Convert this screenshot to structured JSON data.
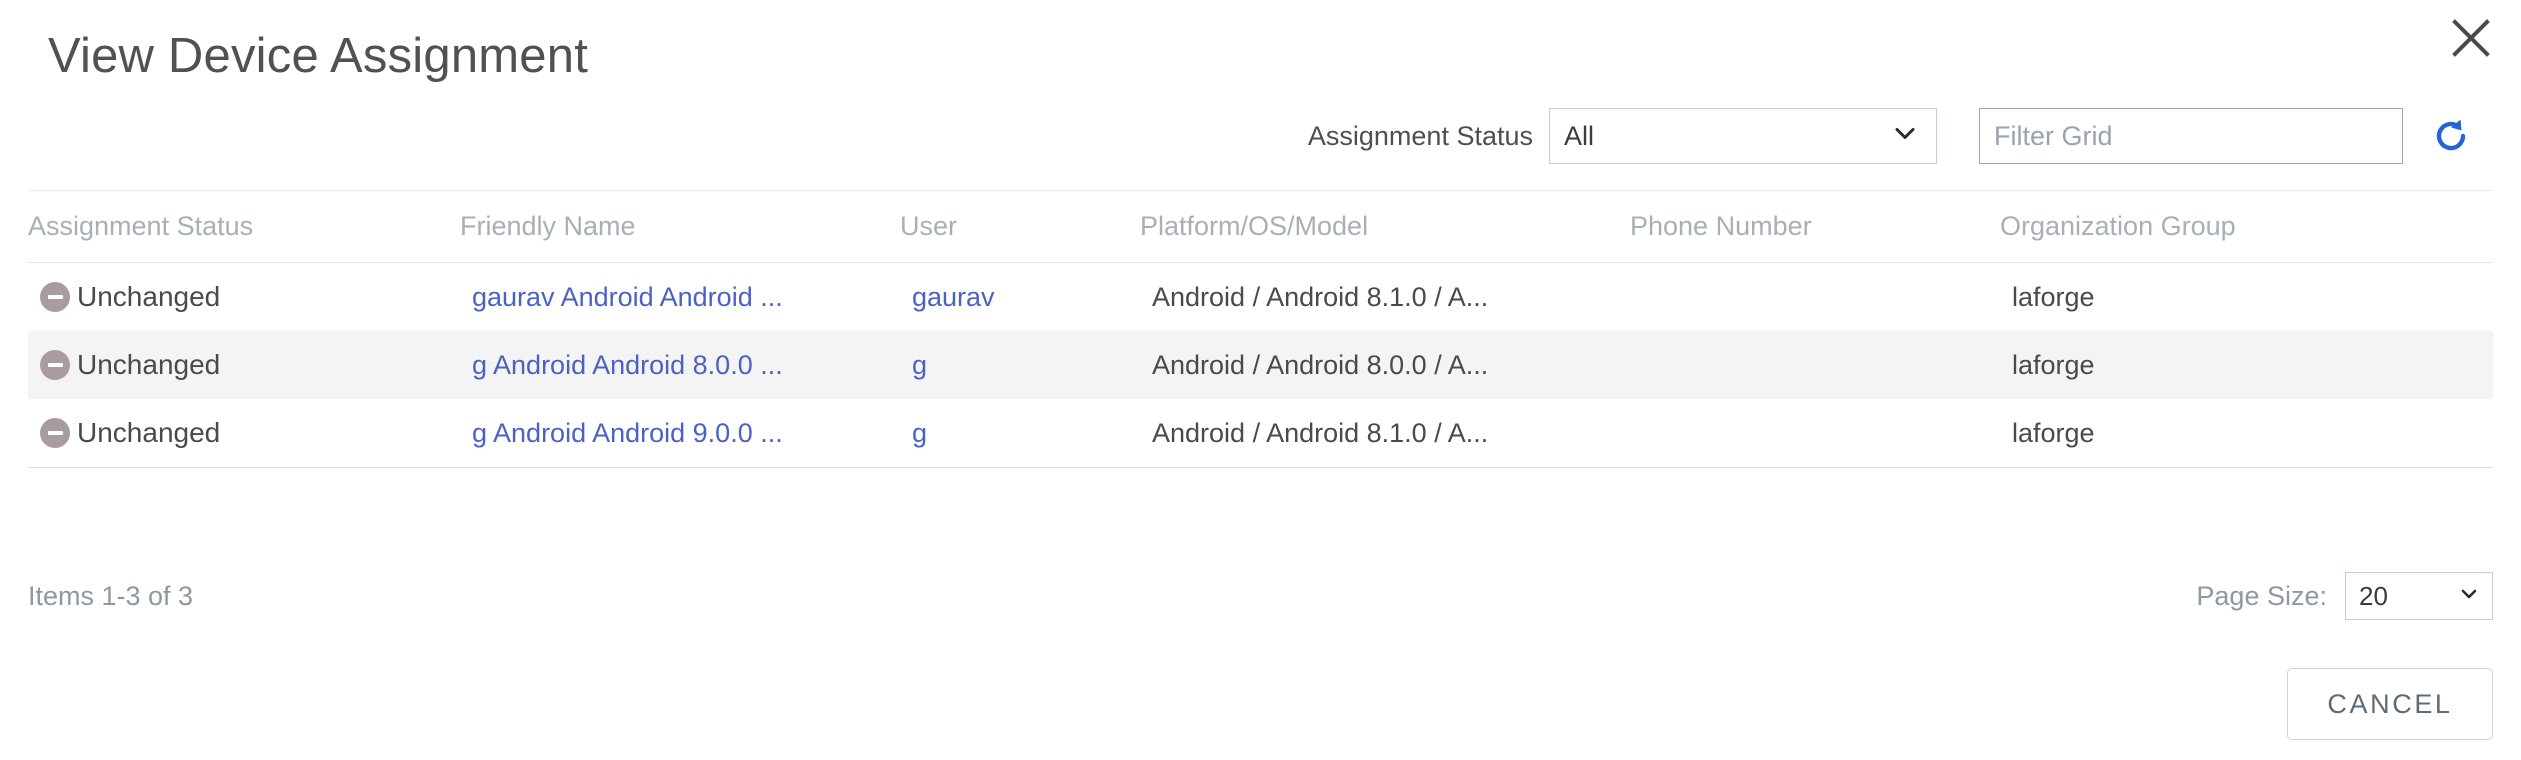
{
  "dialog": {
    "title": "View Device Assignment",
    "close_icon": "close-icon"
  },
  "filter_bar": {
    "status_label": "Assignment Status",
    "status_value": "All",
    "status_options": [
      "All"
    ],
    "filter_placeholder": "Filter Grid",
    "filter_value": "",
    "refresh_icon": "refresh-icon",
    "chevron_icon": "chevron-down-icon"
  },
  "grid": {
    "columns": [
      "Assignment Status",
      "Friendly Name",
      "User",
      "Platform/OS/Model",
      "Phone Number",
      "Organization Group"
    ],
    "rows": [
      {
        "status": "Unchanged",
        "status_icon": "minus-circle-icon",
        "friendly_name": "gaurav Android Android ...",
        "user": "gaurav",
        "platform": "Android / Android 8.1.0 / A...",
        "phone": "",
        "org_group": "laforge"
      },
      {
        "status": "Unchanged",
        "status_icon": "minus-circle-icon",
        "friendly_name": "g Android Android 8.0.0 ...",
        "user": "g",
        "platform": "Android / Android 8.0.0 / A...",
        "phone": "",
        "org_group": "laforge"
      },
      {
        "status": "Unchanged",
        "status_icon": "minus-circle-icon",
        "friendly_name": "g Android Android 9.0.0 ...",
        "user": "g",
        "platform": "Android / Android 8.1.0 / A...",
        "phone": "",
        "org_group": "laforge"
      }
    ]
  },
  "footer": {
    "items_count": "Items 1-3 of 3",
    "page_size_label": "Page Size:",
    "page_size_value": "20",
    "page_size_options": [
      "20"
    ]
  },
  "actions": {
    "cancel_label": "CANCEL"
  },
  "colors": {
    "link": "#4b62c4",
    "accent_refresh": "#2763d6",
    "status_icon": "#a99c9f",
    "header_text": "#a8afb6",
    "alt_row": "#f4f4f4"
  }
}
